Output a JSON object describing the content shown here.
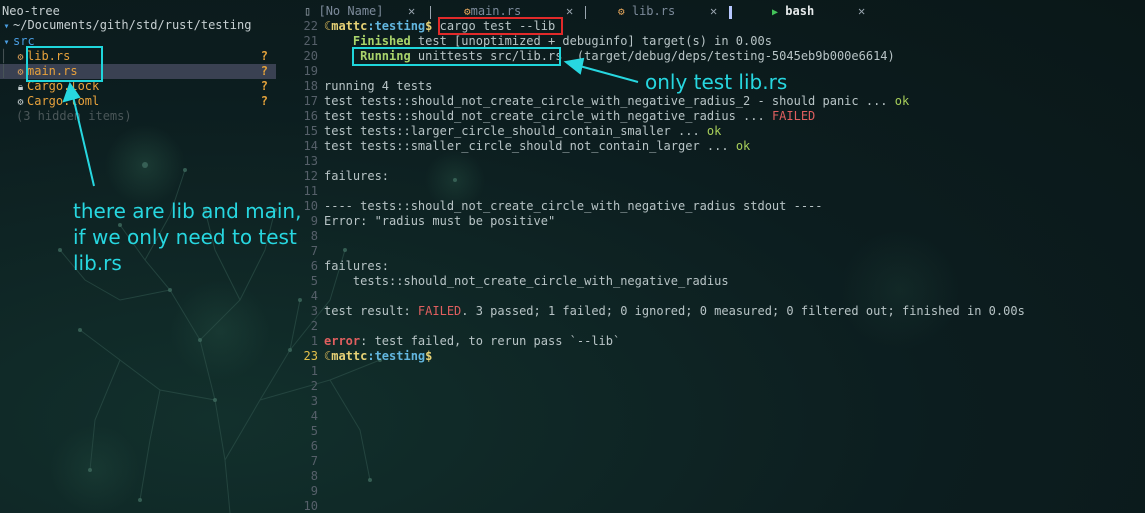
{
  "sidebar": {
    "title": "Neo-tree",
    "root_path": "~/Documents/gith/std/rust/testing",
    "root_icon": "folder-open-icon",
    "items": [
      {
        "label": "src",
        "kind": "folder",
        "icon": "folder-open-icon",
        "git": ""
      },
      {
        "label": "lib.rs",
        "kind": "file",
        "icon": "rust-file-icon",
        "git": "?"
      },
      {
        "label": "main.rs",
        "kind": "file",
        "icon": "rust-file-icon",
        "git": "?",
        "selected": true
      },
      {
        "label": "Cargo.lock",
        "kind": "file",
        "icon": "lock-icon",
        "git": "?"
      },
      {
        "label": "Cargo.toml",
        "kind": "file",
        "icon": "gear-icon",
        "git": "?"
      },
      {
        "label": "(3 hidden items)",
        "kind": "hidden"
      }
    ]
  },
  "tabs": [
    {
      "label": "[No Name]",
      "icon": "file-icon",
      "active": false
    },
    {
      "label": "main.rs",
      "icon": "rust-file-icon",
      "active": false
    },
    {
      "label": "lib.rs",
      "icon": "rust-file-icon",
      "active": false
    },
    {
      "label": "bash",
      "icon": "terminal-icon",
      "active": true
    }
  ],
  "terminal": {
    "prompt_user": "mattc",
    "prompt_dir": "testing",
    "prompt_sigil": "$",
    "command": "cargo test --lib",
    "lines": [
      {
        "num": "22",
        "kind": "prompt_cmd"
      },
      {
        "num": "21",
        "kind": "finished",
        "keyword": "Finished",
        "rest": "test [unoptimized + debuginfo] target(s) in 0.00s"
      },
      {
        "num": "20",
        "kind": "running",
        "keyword": "Running",
        "target": "unittests src/lib.rs",
        "rest": "(target/debug/deps/testing-5045eb9b000e6614)"
      },
      {
        "num": "19",
        "kind": "blank"
      },
      {
        "num": "18",
        "kind": "plain",
        "text": "running 4 tests"
      },
      {
        "num": "17",
        "kind": "result",
        "text": "test tests::should_not_create_circle_with_negative_radius_2 - should panic ... ",
        "status": "ok"
      },
      {
        "num": "16",
        "kind": "result",
        "text": "test tests::should_not_create_circle_with_negative_radius ... ",
        "status": "FAILED"
      },
      {
        "num": "15",
        "kind": "result",
        "text": "test tests::larger_circle_should_contain_smaller ... ",
        "status": "ok"
      },
      {
        "num": "14",
        "kind": "result",
        "text": "test tests::smaller_circle_should_not_contain_larger ... ",
        "status": "ok"
      },
      {
        "num": "13",
        "kind": "blank"
      },
      {
        "num": "12",
        "kind": "plain",
        "text": "failures:"
      },
      {
        "num": "11",
        "kind": "blank"
      },
      {
        "num": "10",
        "kind": "plain",
        "text": "---- tests::should_not_create_circle_with_negative_radius stdout ----"
      },
      {
        "num": "9",
        "kind": "plain",
        "text": "Error: \"radius must be positive\""
      },
      {
        "num": "8",
        "kind": "blank"
      },
      {
        "num": "7",
        "kind": "blank"
      },
      {
        "num": "6",
        "kind": "plain",
        "text": "failures:"
      },
      {
        "num": "5",
        "kind": "plain",
        "text": "    tests::should_not_create_circle_with_negative_radius"
      },
      {
        "num": "4",
        "kind": "blank"
      },
      {
        "num": "3",
        "kind": "summary",
        "prefix": "test result: ",
        "status": "FAILED",
        "rest": ". 3 passed; 1 failed; 0 ignored; 0 measured; 0 filtered out; finished in 0.00s"
      },
      {
        "num": "2",
        "kind": "blank"
      },
      {
        "num": "1",
        "kind": "error",
        "keyword": "error",
        "rest": ": test failed, to rerun pass `--lib`"
      },
      {
        "num": "23",
        "kind": "prompt_cur"
      },
      {
        "num": "1",
        "kind": "blank"
      },
      {
        "num": "2",
        "kind": "blank"
      },
      {
        "num": "3",
        "kind": "blank"
      },
      {
        "num": "4",
        "kind": "blank"
      },
      {
        "num": "5",
        "kind": "blank"
      },
      {
        "num": "6",
        "kind": "blank"
      },
      {
        "num": "7",
        "kind": "blank"
      },
      {
        "num": "8",
        "kind": "blank"
      },
      {
        "num": "9",
        "kind": "blank"
      },
      {
        "num": "10",
        "kind": "blank"
      }
    ]
  },
  "annotations": {
    "sidebar_note": [
      "there are lib and main,",
      "if we only need to test",
      "lib.rs"
    ],
    "terminal_note": "only test lib.rs",
    "colors": {
      "red": "#e22a2a",
      "cyan": "#1fd6dc"
    }
  }
}
